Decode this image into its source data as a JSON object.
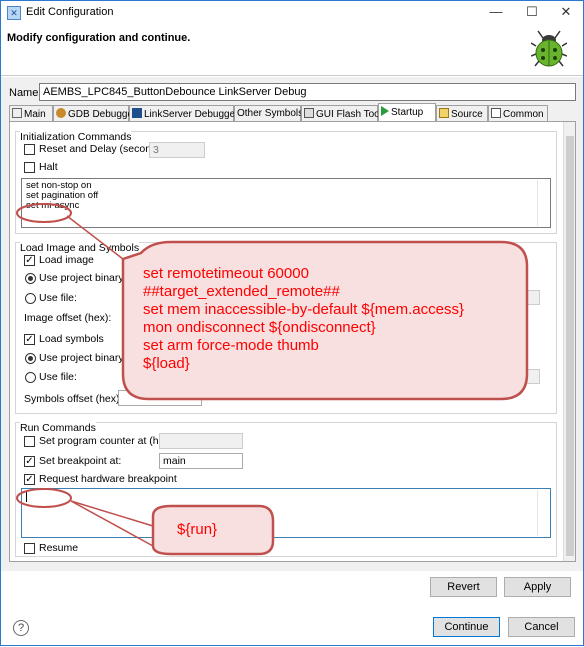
{
  "window": {
    "title": "Edit Configuration",
    "icon": "ide-icon",
    "controls": [
      "minimize-icon",
      "maximize-icon",
      "close-icon"
    ]
  },
  "header": {
    "message": "Modify configuration and continue.",
    "icon": "debug-bug-icon"
  },
  "name": {
    "label": "Name:",
    "value": "AEMBS_LPC845_ButtonDebounce LinkServer Debug"
  },
  "tabs": [
    {
      "label": "Main",
      "icon": "main-tab-icon"
    },
    {
      "label": "GDB Debugger",
      "icon": "gdb-icon"
    },
    {
      "label": "LinkServer Debugger",
      "icon": "linkserver-icon"
    },
    {
      "label": "Other Symbols",
      "icon": ""
    },
    {
      "label": "GUI Flash Tool",
      "icon": "flash-icon"
    },
    {
      "label": "Startup",
      "icon": "startup-icon"
    },
    {
      "label": "Source",
      "icon": "source-icon"
    },
    {
      "label": "Common",
      "icon": "common-icon"
    }
  ],
  "init": {
    "title": "Initialization Commands",
    "reset_label": "Reset and Delay (seconds):",
    "reset_value": "3",
    "halt_label": "Halt",
    "commands": [
      "set non-stop on",
      "set pagination off",
      "set mi-async"
    ]
  },
  "load": {
    "title": "Load Image and Symbols",
    "load_image_label": "Load image",
    "use_project_binary_label": "Use project binary:",
    "use_file_label": "Use file:",
    "image_offset_label": "Image offset (hex):",
    "load_symbols_label": "Load symbols",
    "symbols_offset_label": "Symbols offset (hex):"
  },
  "run": {
    "title": "Run Commands",
    "set_pc_label": "Set program counter at (hex):",
    "set_bp_label": "Set breakpoint at:",
    "set_bp_value": "main",
    "hw_bp_label": "Request hardware breakpoint",
    "resume_label": "Resume"
  },
  "callouts": {
    "big": [
      "set remotetimeout 60000",
      "##target_extended_remote##",
      "set mem inaccessible-by-default ${mem.access}",
      "mon ondisconnect ${ondisconnect}",
      "set arm force-mode thumb",
      "${load}"
    ],
    "small": "${run}",
    "fill": "#f9e0e0",
    "stroke": "#c0504d",
    "text_color": "#ff0000"
  },
  "buttons": {
    "revert": "Revert",
    "apply": "Apply",
    "continue": "Continue",
    "cancel": "Cancel",
    "help": "?"
  }
}
